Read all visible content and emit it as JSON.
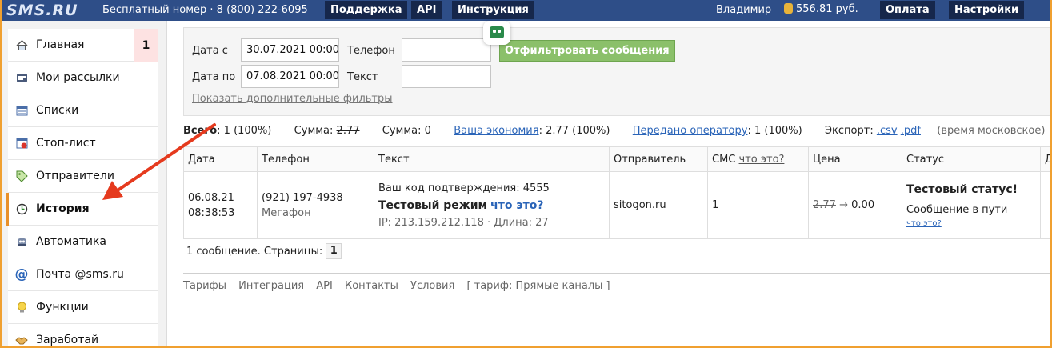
{
  "header": {
    "logo": "SMS.RU",
    "free_number": "Бесплатный номер · 8 (800) 222-6095",
    "nav": [
      "Поддержка",
      "API",
      "Инструкция"
    ],
    "user": "Владимир",
    "balance": "556.81 руб.",
    "pay": "Оплата",
    "settings": "Настройки"
  },
  "sidebar": {
    "items": [
      {
        "label": "Главная",
        "icon": "home-icon",
        "badge": "1"
      },
      {
        "label": "Мои рассылки",
        "icon": "mailing-icon"
      },
      {
        "label": "Списки",
        "icon": "list-icon"
      },
      {
        "label": "Стоп-лист",
        "icon": "stoplist-icon"
      },
      {
        "label": "Отправители",
        "icon": "tag-icon"
      },
      {
        "label": "История",
        "icon": "clock-icon",
        "active": true
      },
      {
        "label": "Автоматика",
        "icon": "robot-icon"
      },
      {
        "label": "Почта @sms.ru",
        "icon": "at-icon"
      },
      {
        "label": "Функции",
        "icon": "bulb-icon"
      },
      {
        "label": "Заработай",
        "icon": "handshake-icon"
      }
    ]
  },
  "filter": {
    "date_from_label": "Дата с",
    "date_from_value": "30.07.2021 00:00",
    "date_to_label": "Дата по",
    "date_to_value": "07.08.2021 00:00",
    "phone_label": "Телефон",
    "phone_value": "",
    "text_label": "Текст",
    "text_value": "",
    "filter_button": "Отфильтровать сообщения",
    "more_filters": "Показать дополнительные фильтры"
  },
  "stats": {
    "total_label": "Всего",
    "total_value": ": 1 (100%)",
    "sum1_label": "Сумма:",
    "sum1_value": "2.77",
    "sum2_label": "Сумма: 0",
    "savings_link": "Ваша экономия",
    "savings_value": ": 2.77 (100%)",
    "operator_link": "Передано оператору",
    "operator_value": ": 1 (100%)",
    "export_label": "Экспорт:",
    "export_csv": ".csv",
    "export_pdf": ".pdf",
    "timezone": "(время московское)"
  },
  "table": {
    "headers": {
      "date": "Дата",
      "phone": "Телефон",
      "text": "Текст",
      "sender": "Отправитель",
      "sms": "СМС",
      "sms_link": "что это?",
      "price": "Цена",
      "status": "Статус",
      "extra": "Д"
    },
    "row": {
      "date": "06.08.21",
      "time": "08:38:53",
      "phone": "(921) 197-4938",
      "operator": "Мегафон",
      "text_line": "Ваш код подтверждения: 4555",
      "mode": "Тестовый режим",
      "mode_link": "что это?",
      "meta": "IP: 213.159.212.118 · Длина: 27",
      "sender": "sitogon.ru",
      "sms_count": "1",
      "price_old": "2.77",
      "price_arrow": "→",
      "price_new": "0.00",
      "status_title": "Тестовый статус!",
      "status_text": "Сообщение в пути",
      "status_link": "что это?"
    }
  },
  "pager": {
    "label": "1 сообщение. Страницы:",
    "page": "1"
  },
  "footer": {
    "links": [
      "Тарифы",
      "Интеграция",
      "API",
      "Контакты",
      "Условия"
    ],
    "tariff": "[ тариф: Прямые каналы ]"
  },
  "colors": {
    "header_bg": "#2e4e88",
    "button_bg": "#16274b",
    "filter_button": "#8bc06a",
    "link": "#2a64b8",
    "active_marker": "#e8902a",
    "annotation_arrow": "#e53a1e"
  }
}
